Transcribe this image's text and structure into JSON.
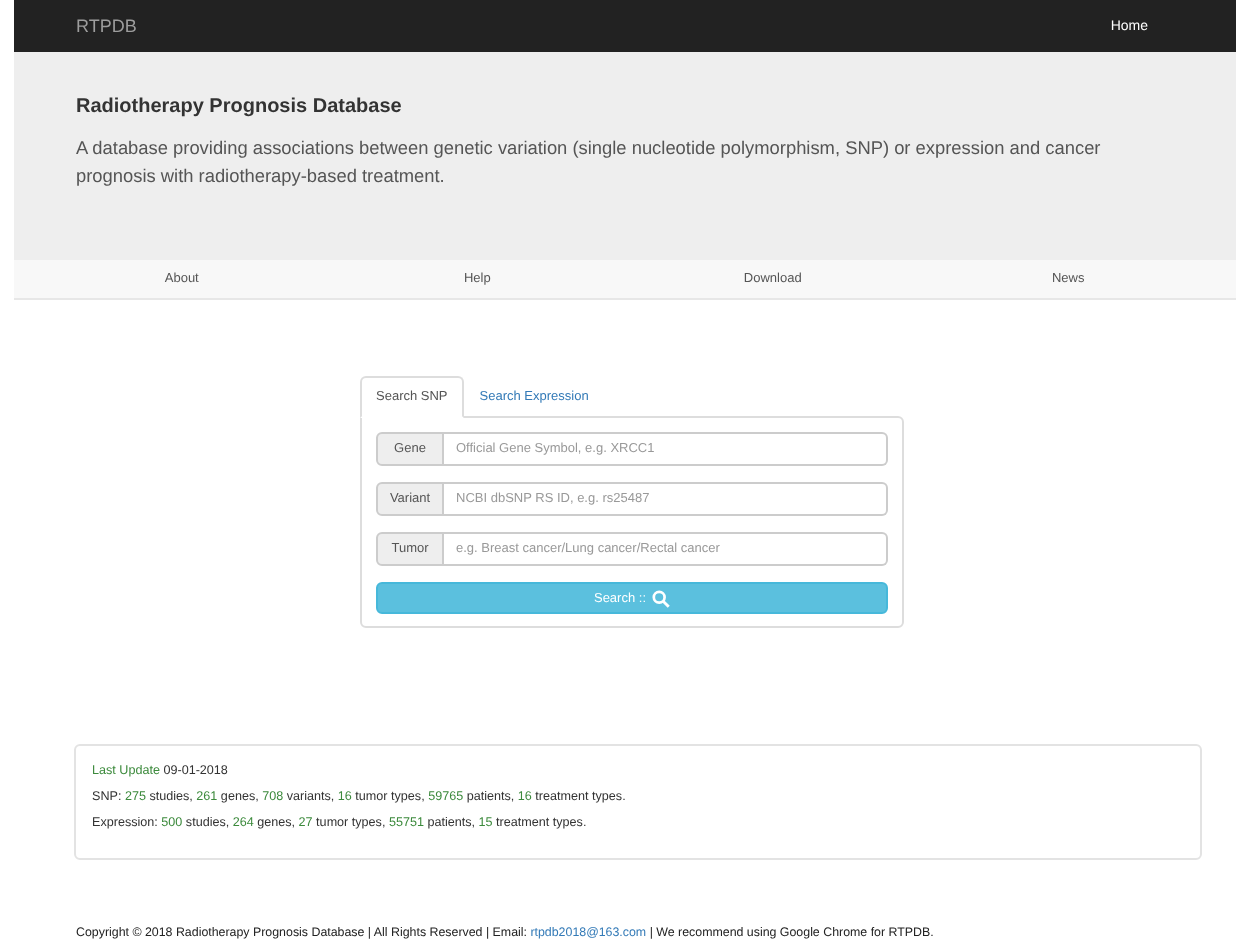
{
  "navbar": {
    "brand": "RTPDB",
    "links": [
      "Home"
    ]
  },
  "header": {
    "title": "Radiotherapy Prognosis Database",
    "description": "A database providing associations between genetic variation (single nucleotide polymorphism, SNP) or expression and cancer prognosis with radiotherapy-based treatment."
  },
  "nav": [
    "About",
    "Help",
    "Download",
    "News"
  ],
  "search": {
    "tabs": [
      {
        "label": "Search SNP",
        "selected": true
      },
      {
        "label": "Search Expression",
        "selected": false
      }
    ],
    "fields": [
      {
        "label": "Gene",
        "placeholder": "Official Gene Symbol, e.g. XRCC1"
      },
      {
        "label": "Variant",
        "placeholder": "NCBI dbSNP RS ID, e.g. rs25487"
      },
      {
        "label": "Tumor",
        "placeholder": "e.g. Breast cancer/Lung cancer/Rectal cancer"
      }
    ],
    "button": "Search ::"
  },
  "stats": [
    [
      {
        "text": "Last Update",
        "highlight": true
      },
      {
        "text": " 09-01-2018",
        "highlight": false
      }
    ],
    [
      {
        "text": "SNP: ",
        "highlight": false
      },
      {
        "text": "275",
        "highlight": true
      },
      {
        "text": " studies, ",
        "highlight": false
      },
      {
        "text": "261",
        "highlight": true
      },
      {
        "text": " genes, ",
        "highlight": false
      },
      {
        "text": "708",
        "highlight": true
      },
      {
        "text": " variants, ",
        "highlight": false
      },
      {
        "text": "16",
        "highlight": true
      },
      {
        "text": " tumor types, ",
        "highlight": false
      },
      {
        "text": "59765",
        "highlight": true
      },
      {
        "text": " patients, ",
        "highlight": false
      },
      {
        "text": "16",
        "highlight": true
      },
      {
        "text": " treatment types.",
        "highlight": false
      }
    ],
    [
      {
        "text": "Expression: ",
        "highlight": false
      },
      {
        "text": "500",
        "highlight": true
      },
      {
        "text": " studies, ",
        "highlight": false
      },
      {
        "text": "264",
        "highlight": true
      },
      {
        "text": " genes, ",
        "highlight": false
      },
      {
        "text": "27",
        "highlight": true
      },
      {
        "text": " tumor types, ",
        "highlight": false
      },
      {
        "text": "55751",
        "highlight": true
      },
      {
        "text": " patients, ",
        "highlight": false
      },
      {
        "text": "15",
        "highlight": true
      },
      {
        "text": " treatment types.",
        "highlight": false
      }
    ]
  ],
  "footer": {
    "before": "Copyright © 2018 Radiotherapy Prognosis Database | All Rights Reserved | Email: ",
    "email": "rtpdb2018@163.com",
    "after": " | We recommend using Google Chrome for RTPDB."
  }
}
